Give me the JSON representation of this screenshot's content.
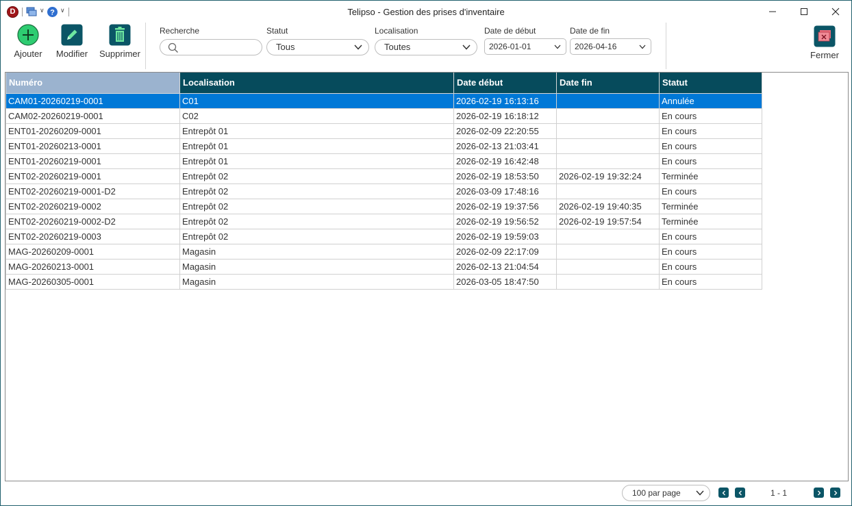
{
  "window": {
    "title": "Telipso - Gestion des prises d'inventaire",
    "app_logo_letter": "D",
    "quick_access_icons": [
      "screens-icon",
      "help-icon"
    ]
  },
  "toolbar": {
    "add_label": "Ajouter",
    "edit_label": "Modifier",
    "delete_label": "Supprimer",
    "close_label": "Fermer",
    "accent_color": "#0b5566",
    "add_color": "#2ecc71"
  },
  "filters": {
    "search_label": "Recherche",
    "search_value": "",
    "status_label": "Statut",
    "status_value": "Tous",
    "location_label": "Localisation",
    "location_value": "Toutes",
    "start_date_label": "Date de début",
    "start_date_value": "2026-01-01",
    "end_date_label": "Date de fin",
    "end_date_value": "2026-04-16"
  },
  "table": {
    "columns": [
      "Numéro",
      "Localisation",
      "Date début",
      "Date fin",
      "Statut"
    ],
    "sorted_column": "Numéro",
    "header_color": "#064b5c",
    "selected_color": "#0078d7",
    "selected_row": 0,
    "rows": [
      [
        "CAM01-20260219-0001",
        "C01",
        "2026-02-19 16:13:16",
        "",
        "Annulée"
      ],
      [
        "CAM02-20260219-0001",
        "C02",
        "2026-02-19 16:18:12",
        "",
        "En cours"
      ],
      [
        "ENT01-20260209-0001",
        "Entrepôt 01",
        "2026-02-09 22:20:55",
        "",
        "En cours"
      ],
      [
        "ENT01-20260213-0001",
        "Entrepôt 01",
        "2026-02-13 21:03:41",
        "",
        "En cours"
      ],
      [
        "ENT01-20260219-0001",
        "Entrepôt 01",
        "2026-02-19 16:42:48",
        "",
        "En cours"
      ],
      [
        "ENT02-20260219-0001",
        "Entrepôt 02",
        "2026-02-19 18:53:50",
        "2026-02-19 19:32:24",
        "Terminée"
      ],
      [
        "ENT02-20260219-0001-D2",
        "Entrepôt 02",
        "2026-03-09 17:48:16",
        "",
        "En cours"
      ],
      [
        "ENT02-20260219-0002",
        "Entrepôt 02",
        "2026-02-19 19:37:56",
        "2026-02-19 19:40:35",
        "Terminée"
      ],
      [
        "ENT02-20260219-0002-D2",
        "Entrepôt 02",
        "2026-02-19 19:56:52",
        "2026-02-19 19:57:54",
        "Terminée"
      ],
      [
        "ENT02-20260219-0003",
        "Entrepôt 02",
        "2026-02-19 19:59:03",
        "",
        "En cours"
      ],
      [
        "MAG-20260209-0001",
        "Magasin",
        "2026-02-09 22:17:09",
        "",
        "En cours"
      ],
      [
        "MAG-20260213-0001",
        "Magasin",
        "2026-02-13 21:04:54",
        "",
        "En cours"
      ],
      [
        "MAG-20260305-0001",
        "Magasin",
        "2026-03-05 18:47:50",
        "",
        "En cours"
      ]
    ]
  },
  "pagination": {
    "per_page": "100 par page",
    "page_info": "1 - 1"
  }
}
